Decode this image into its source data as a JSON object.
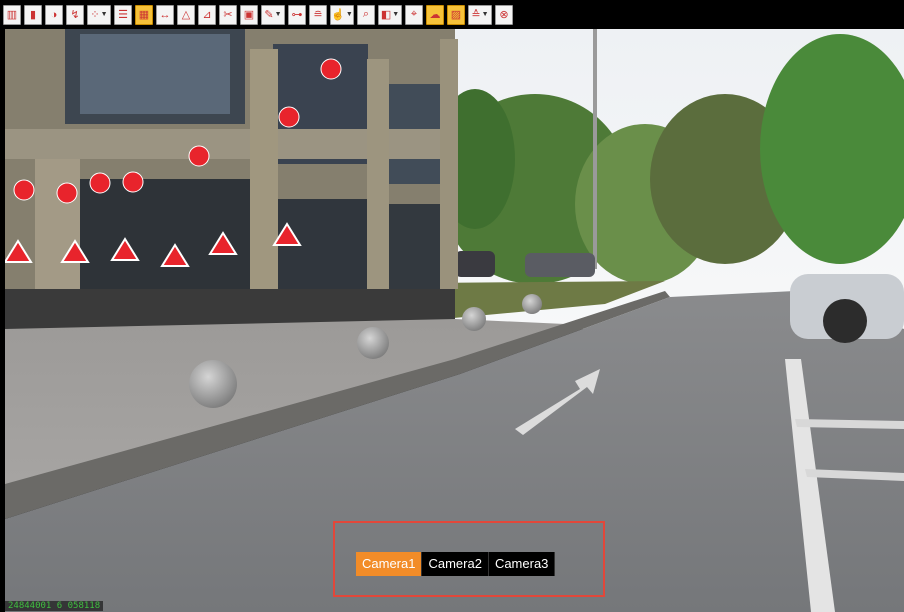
{
  "toolbar": {
    "buttons": [
      {
        "name": "layer-icon",
        "glyph": "▥"
      },
      {
        "name": "bar-chart-icon",
        "glyph": "▮"
      },
      {
        "name": "color-palette-icon",
        "glyph": "◑"
      },
      {
        "name": "route-icon",
        "glyph": "↯"
      },
      {
        "name": "point-group-icon",
        "glyph": "⁘",
        "dropdown": true
      },
      {
        "name": "filter-icon",
        "glyph": "☰"
      },
      {
        "name": "classify-icon",
        "glyph": "▦",
        "active": true
      },
      {
        "name": "distance-icon",
        "glyph": "↔"
      },
      {
        "name": "triangle-measure-icon",
        "glyph": "△"
      },
      {
        "name": "angle-icon",
        "glyph": "⊿"
      },
      {
        "name": "cut-icon",
        "glyph": "✂"
      },
      {
        "name": "box-select-icon",
        "glyph": "▣"
      },
      {
        "name": "brush-icon",
        "glyph": "✎",
        "dropdown": true
      },
      {
        "name": "link-icon",
        "glyph": "⊶"
      },
      {
        "name": "slice-icon",
        "glyph": "≘"
      },
      {
        "name": "pointer-icon",
        "glyph": "☝",
        "dropdown": true
      },
      {
        "name": "zoom-icon",
        "glyph": "⌕"
      },
      {
        "name": "view-cube-icon",
        "glyph": "◧",
        "dropdown": true
      },
      {
        "name": "target-icon",
        "glyph": "⌖"
      },
      {
        "name": "cloud-icon",
        "glyph": "☁",
        "active": true
      },
      {
        "name": "image-icon",
        "glyph": "▨",
        "active": true
      },
      {
        "name": "layers-stack-icon",
        "glyph": "≙",
        "dropdown": true
      },
      {
        "name": "close-circle-icon",
        "glyph": "⊗"
      }
    ]
  },
  "coordinate_readout": "24844001 6 058118",
  "camera_tabs": [
    {
      "label": "Camera1",
      "active": true
    },
    {
      "label": "Camera2",
      "active": false
    },
    {
      "label": "Camera3",
      "active": false
    }
  ],
  "colors": {
    "accent": "#f28c28",
    "marker": "#e8242c",
    "highlight_box": "#e2473a"
  }
}
